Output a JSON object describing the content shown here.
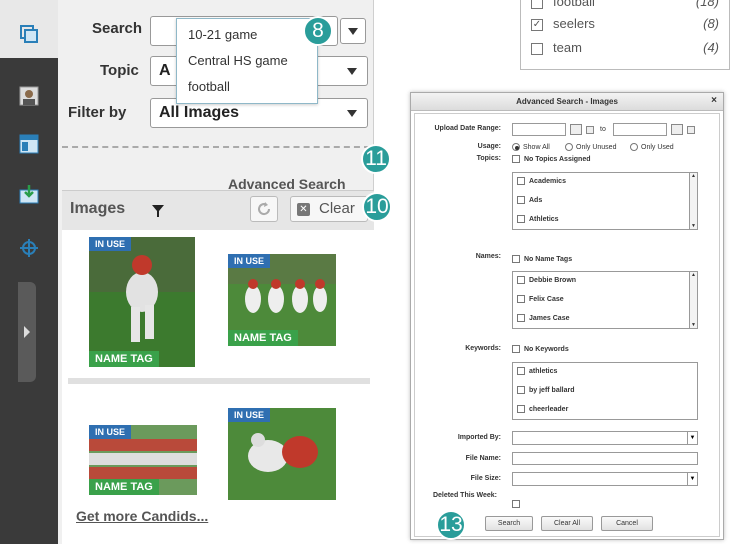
{
  "search_panel": {
    "search_label": "Search",
    "topic_label": "Topic",
    "topic_value": "A",
    "filter_label": "Filter by",
    "filter_value": "All Images",
    "suggestions": [
      "10-21 game",
      "Central HS game",
      "football"
    ],
    "advanced_search_label": "Advanced Search",
    "images_title": "Images",
    "clear_label": "Clear",
    "get_more_label": "Get more Candids...",
    "thumbnails": [
      {
        "top_tag": "IN USE",
        "bottom_tag": "NAME TAG"
      },
      {
        "top_tag": "IN USE",
        "bottom_tag": "NAME TAG"
      },
      {
        "top_tag": "IN USE",
        "bottom_tag": "NAME TAG"
      },
      {
        "top_tag": "IN USE",
        "bottom_tag": ""
      }
    ]
  },
  "callouts": {
    "b8": "8",
    "b10": "10",
    "b11": "11",
    "b13": "13"
  },
  "checklist": {
    "items": [
      {
        "label": "football",
        "count": "(18)",
        "checked": false
      },
      {
        "label": "seelers",
        "count": "(8)",
        "checked": true
      },
      {
        "label": "team",
        "count": "(4)",
        "checked": false
      }
    ]
  },
  "dialog": {
    "title": "Advanced Search - Images",
    "close": "×",
    "upload_label": "Upload Date Range:",
    "to_label": "to",
    "usage_label": "Usage:",
    "usage_options": [
      "Show All",
      "Only Unused",
      "Only Used"
    ],
    "topics_label": "Topics:",
    "no_topics": "No Topics Assigned",
    "topics_list": [
      "Academics",
      "Ads",
      "Athletics"
    ],
    "names_label": "Names:",
    "no_names": "No Name Tags",
    "names_list": [
      "Debbie Brown",
      "Felix Case",
      "James Case"
    ],
    "keywords_label": "Keywords:",
    "no_keywords": "No Keywords",
    "keywords_list": [
      "athletics",
      "by jeff ballard",
      "cheerleader"
    ],
    "imported_label": "Imported By:",
    "filename_label": "File Name:",
    "filesize_label": "File Size:",
    "deleted_label": "Deleted This Week:",
    "search_btn": "Search",
    "clearall_btn": "Clear All",
    "cancel_btn": "Cancel"
  },
  "colors": {
    "accent": "#2a9d9a",
    "in_use": "#2f6fb1",
    "name_tag": "#3aa14a"
  }
}
